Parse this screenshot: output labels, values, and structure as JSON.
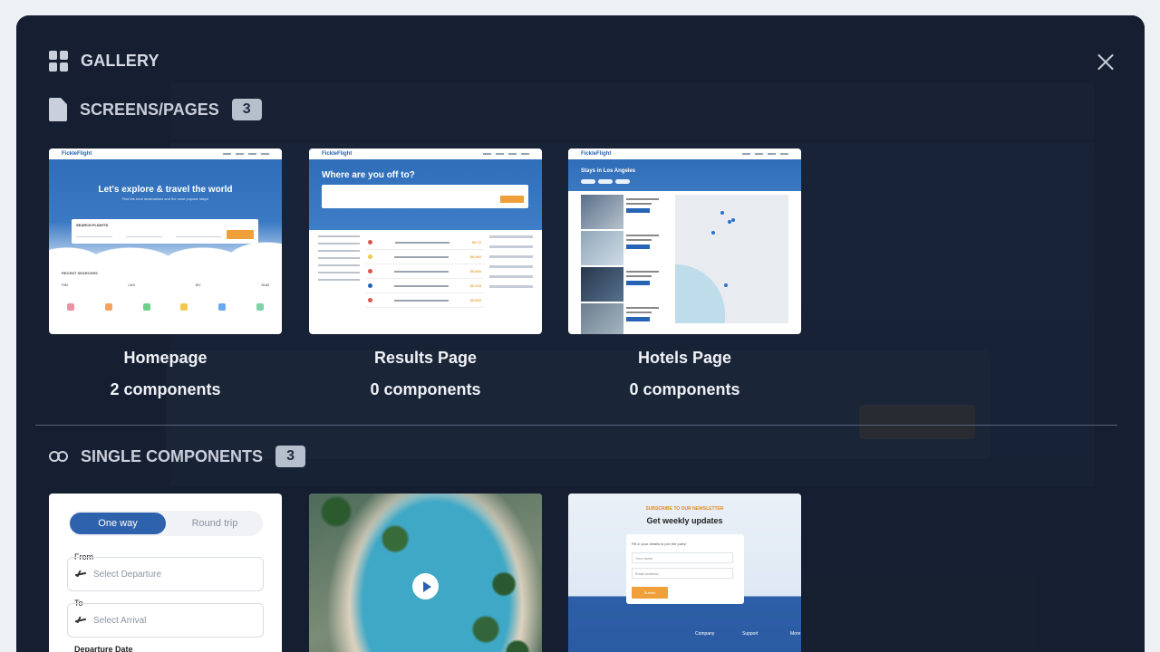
{
  "gallery": {
    "title": "GALLERY",
    "close_label": "Close gallery"
  },
  "screens_section": {
    "title": "SCREENS/PAGES",
    "count": "3",
    "items": [
      {
        "name": "Homepage",
        "components": "2 components",
        "preview": {
          "logo": "FickleFlight",
          "headline": "Let's explore & travel the world",
          "subline": "Find the best destinations and the most popular stays!",
          "search_label": "SEARCH FLIGHTS",
          "recent_label": "RECENT SEARCHES",
          "flight_a": "SIN",
          "flight_b": "LAX",
          "flight_c": "MY",
          "flight_d": "DUB"
        }
      },
      {
        "name": "Results Page",
        "components": "0 components",
        "preview": {
          "logo": "FickleFlight",
          "headline": "Where are you off to?",
          "price_a": "$0.72",
          "price_b": "$0.460",
          "price_c": "$0.850",
          "price_d": "$0.478",
          "price_e": "$0.850"
        }
      },
      {
        "name": "Hotels Page",
        "components": "0 components",
        "preview": {
          "logo": "FickleFlight",
          "headline": "Stays in Los Angeles"
        }
      }
    ]
  },
  "components_section": {
    "title": "SINGLE COMPONENTS",
    "count": "3",
    "flight_form": {
      "tab_active": "One way",
      "tab_inactive": "Round trip",
      "from_label": "From",
      "from_placeholder": "Select Departure",
      "to_label": "To",
      "to_placeholder": "Select Arrival",
      "date_label": "Departure Date"
    },
    "newsletter": {
      "kicker": "SUBSCRIBE TO OUR NEWSLETTER",
      "title": "Get weekly updates",
      "prompt": "Fill in your details to join the party!",
      "name_placeholder": "Your name",
      "email_placeholder": "Email address",
      "submit": "Submit",
      "footer_company": "Company",
      "footer_support": "Support",
      "footer_more": "More"
    }
  },
  "colors": {
    "backdrop": "#1f2a3d",
    "brand_blue": "#2f62ad",
    "accent_orange": "#f0a03a"
  }
}
